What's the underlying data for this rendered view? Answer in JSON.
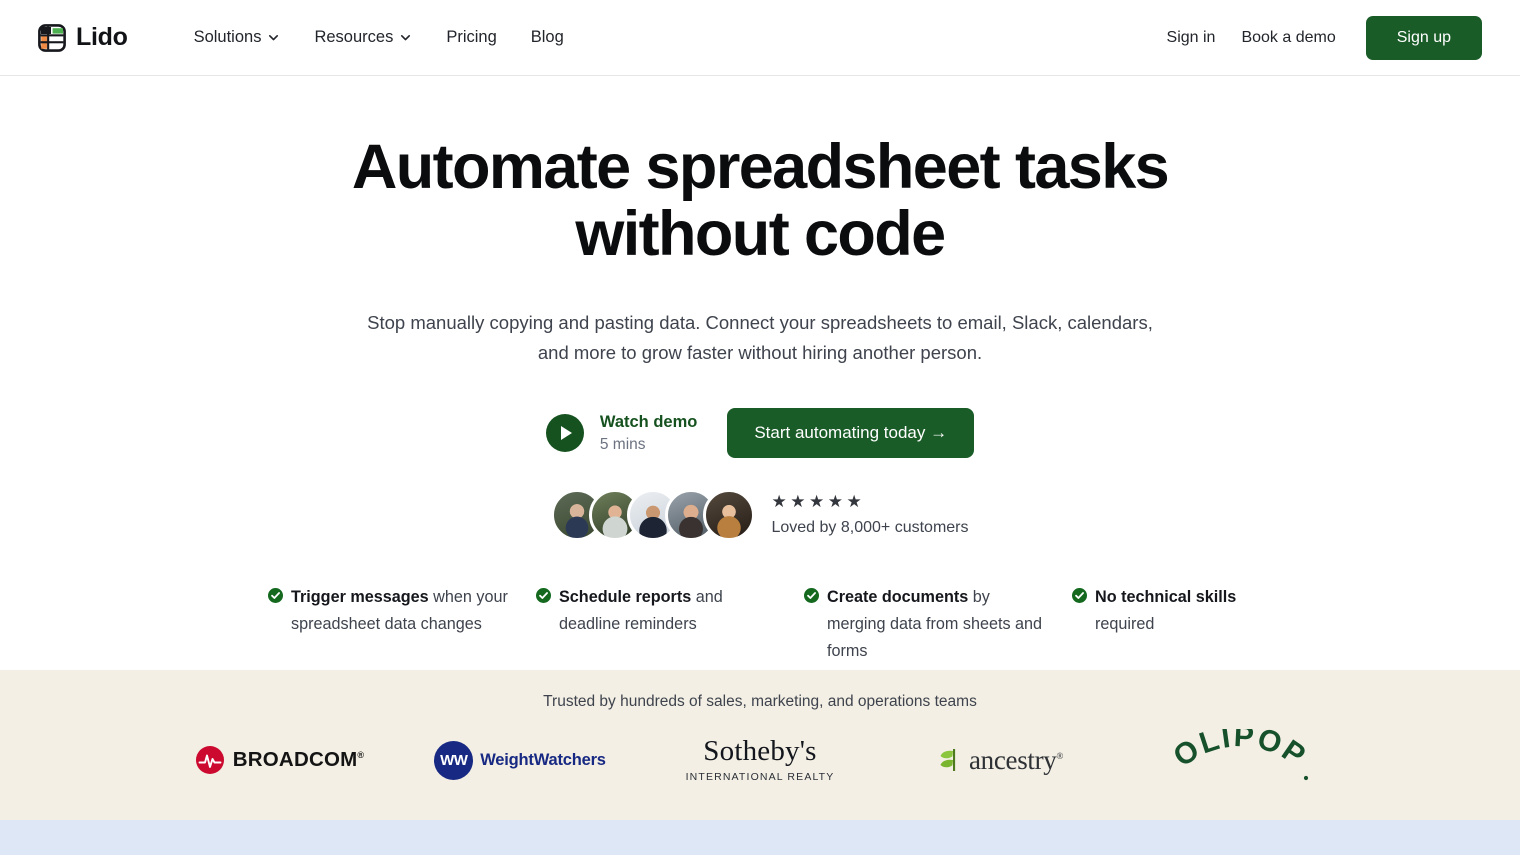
{
  "brand": {
    "name": "Lido",
    "logo_icon": "lido-grid-icon"
  },
  "nav": {
    "items": [
      {
        "label": "Solutions",
        "has_dropdown": true
      },
      {
        "label": "Resources",
        "has_dropdown": true
      },
      {
        "label": "Pricing",
        "has_dropdown": false
      },
      {
        "label": "Blog",
        "has_dropdown": false
      }
    ],
    "sign_in": "Sign in",
    "book_demo": "Book a demo",
    "sign_up": "Sign up"
  },
  "hero": {
    "title_line1": "Automate spreadsheet tasks",
    "title_line2": "without code",
    "subtitle": "Stop manually copying and pasting data. Connect your spreadsheets to email, Slack, calendars, and more to grow faster without hiring another person.",
    "watch_demo": {
      "label": "Watch demo",
      "duration": "5 mins",
      "icon": "play-icon"
    },
    "primary_cta": "Start automating today  →"
  },
  "social_proof": {
    "stars": "★ ★ ★ ★ ★",
    "star_count": 5,
    "caption": "Loved by 8,000+ customers",
    "avatar_count": 5
  },
  "features": [
    {
      "bold": "Trigger messages",
      "rest": " when your spreadsheet data changes"
    },
    {
      "bold": "Schedule reports",
      "rest": " and deadline reminders"
    },
    {
      "bold": "Create documents",
      "rest": " by merging data from sheets and forms"
    },
    {
      "bold": "No technical skills",
      "rest": " required"
    }
  ],
  "trust": {
    "label": "Trusted by hundreds of sales, marketing, and operations teams",
    "logos": [
      {
        "name": "Broadcom",
        "wordmark": "BROADCOM",
        "tm": "®"
      },
      {
        "name": "WeightWatchers",
        "wordmark": "WeightWatchers",
        "mark": "WW"
      },
      {
        "name": "Sotheby's",
        "wordmark": "Sotheby's",
        "tagline": "INTERNATIONAL REALTY"
      },
      {
        "name": "ancestry",
        "wordmark": "ancestry",
        "tm": "®"
      },
      {
        "name": "OLIPOP",
        "wordmark": "OLIPOP"
      }
    ]
  },
  "colors": {
    "brand_green": "#1a5c28",
    "dark_green": "#16521f",
    "beige_band": "#f3efe4",
    "blue_stripe": "#dee7f5",
    "broadcom_red": "#cc092f",
    "ww_navy": "#172983",
    "ancestry_green": "#8cc63f",
    "olipop_green": "#17512b"
  }
}
